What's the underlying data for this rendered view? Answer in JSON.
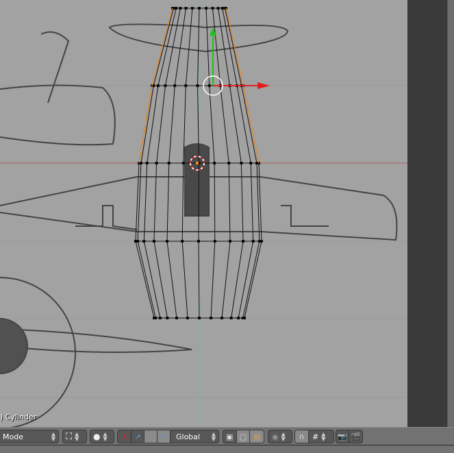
{
  "viewport": {
    "object_label": ") Cylinder",
    "background": "#a2a2a2"
  },
  "header": {
    "mode_label": "Mode",
    "pivot_icon": "pivot-bounding-box-icon",
    "shading_icon": "viewport-shading-icon",
    "manipulator_icons": [
      "manipulator-toggle-icon",
      "translate-icon",
      "rotate-icon",
      "scale-icon"
    ],
    "orientation_label": "Global",
    "select_mode_icons": [
      "vertex-select-icon",
      "edge-select-icon",
      "face-select-icon"
    ],
    "proportional_icon": "proportional-edit-icon",
    "snap_icons": [
      "magnet-icon",
      "snap-element-icon"
    ],
    "render_icons": [
      "opengl-render-icon",
      "opengl-render-animation-icon"
    ]
  },
  "colors": {
    "x_axis": "#e02020",
    "y_axis": "#20c020",
    "edge_selected": "#f09020"
  }
}
